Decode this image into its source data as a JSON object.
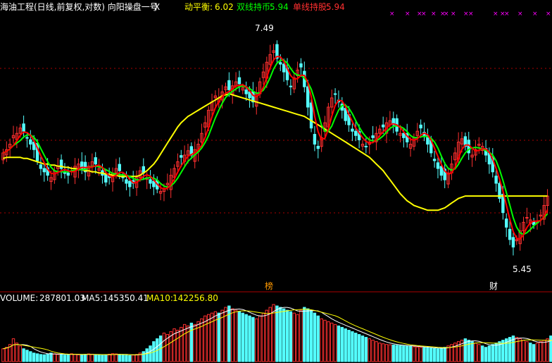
{
  "header": {
    "title": "海油工程(日线,前复权,对数) 向阳操盘一号",
    "close_mark": "X",
    "indicators": [
      {
        "label": "动平衡:",
        "value": "6.02",
        "color": "#ffff00"
      },
      {
        "label": "双线持币:",
        "value": "5.94",
        "color": "#00ff00"
      },
      {
        "label": "单线持股:",
        "value": "5.94",
        "color": "#ff3030"
      }
    ]
  },
  "volume_header": {
    "volume": {
      "label": "VOLUME:",
      "value": "287801.03"
    },
    "ma5": {
      "label": "MA5:",
      "value": "145350.41"
    },
    "ma10": {
      "label": "MA10:",
      "value": "142256.80"
    }
  },
  "markers": [
    {
      "label": "榜",
      "color": "#ff9900"
    },
    {
      "label": "财",
      "color": "#ffffff"
    }
  ],
  "colors": {
    "up": "#ff3030",
    "down": "#54ffff",
    "ma_slow": "#ffff00",
    "line_green": "#00ff00",
    "line_red": "#ff0000",
    "grid": "#aa0000",
    "sell_marker": "#ff00ff",
    "buy_arrow": "#00ff00",
    "sell_arrow": "#ff3030"
  },
  "chart_data": {
    "type": "candlestick",
    "price_scale": "log",
    "ylim": [
      5.25,
      7.7
    ],
    "annotations": [
      {
        "text": "7.49",
        "kind": "high",
        "value": 7.49
      },
      {
        "text": "5.45",
        "kind": "low",
        "value": 5.45
      }
    ],
    "candles_close": [
      6.32,
      6.35,
      6.4,
      6.48,
      6.5,
      6.55,
      6.52,
      6.46,
      6.4,
      6.35,
      6.25,
      6.18,
      6.15,
      6.12,
      6.1,
      6.16,
      6.2,
      6.18,
      6.14,
      6.12,
      6.16,
      6.2,
      6.22,
      6.18,
      6.15,
      6.2,
      6.24,
      6.22,
      6.18,
      6.12,
      6.06,
      6.1,
      6.14,
      6.18,
      6.16,
      6.1,
      6.05,
      6.02,
      6.05,
      6.1,
      6.16,
      6.14,
      6.1,
      6.05,
      6.02,
      6.0,
      5.98,
      6.0,
      6.05,
      6.12,
      6.18,
      6.24,
      6.28,
      6.3,
      6.34,
      6.3,
      6.35,
      6.4,
      6.5,
      6.6,
      6.72,
      6.8,
      6.86,
      6.84,
      6.9,
      6.95,
      6.92,
      6.96,
      7.0,
      6.98,
      6.94,
      6.88,
      6.84,
      6.8,
      6.88,
      7.0,
      7.1,
      7.2,
      7.28,
      7.32,
      7.24,
      7.18,
      7.1,
      7.02,
      6.95,
      7.04,
      7.12,
      7.15,
      6.95,
      6.75,
      6.55,
      6.4,
      6.36,
      6.46,
      6.6,
      6.75,
      6.84,
      6.88,
      6.8,
      6.72,
      6.62,
      6.58,
      6.52,
      6.48,
      6.44,
      6.4,
      6.38,
      6.42,
      6.46,
      6.5,
      6.54,
      6.56,
      6.6,
      6.62,
      6.58,
      6.52,
      6.5,
      6.46,
      6.42,
      6.4,
      6.46,
      6.52,
      6.55,
      6.48,
      6.4,
      6.32,
      6.25,
      6.18,
      6.12,
      6.08,
      6.14,
      6.22,
      6.32,
      6.42,
      6.45,
      6.38,
      6.32,
      6.3,
      6.35,
      6.4,
      6.38,
      6.3,
      6.22,
      6.15,
      6.05,
      5.92,
      5.8,
      5.68,
      5.58,
      5.52,
      5.58,
      5.65,
      5.72,
      5.76,
      5.74,
      5.7,
      5.72,
      5.78,
      5.86,
      5.94
    ],
    "ma_slow": [
      6.27,
      6.28,
      6.28,
      6.28,
      6.28,
      6.28,
      6.27,
      6.27,
      6.26,
      6.25,
      6.24,
      6.23,
      6.22,
      6.22,
      6.21,
      6.21,
      6.2,
      6.2,
      6.19,
      6.19,
      6.18,
      6.18,
      6.17,
      6.17,
      6.16,
      6.16,
      6.15,
      6.15,
      6.14,
      6.14,
      6.13,
      6.13,
      6.12,
      6.12,
      6.11,
      6.11,
      6.11,
      6.11,
      6.11,
      6.11,
      6.12,
      6.14,
      6.16,
      6.19,
      6.22,
      6.26,
      6.31,
      6.36,
      6.41,
      6.46,
      6.51,
      6.56,
      6.6,
      6.63,
      6.66,
      6.68,
      6.7,
      6.72,
      6.74,
      6.76,
      6.78,
      6.8,
      6.82,
      6.84,
      6.86,
      6.87,
      6.88,
      6.87,
      6.86,
      6.85,
      6.84,
      6.83,
      6.82,
      6.81,
      6.8,
      6.79,
      6.78,
      6.77,
      6.76,
      6.75,
      6.74,
      6.73,
      6.72,
      6.71,
      6.7,
      6.69,
      6.68,
      6.67,
      6.66,
      6.64,
      6.62,
      6.6,
      6.58,
      6.56,
      6.54,
      6.52,
      6.5,
      6.48,
      6.46,
      6.44,
      6.42,
      6.4,
      6.38,
      6.36,
      6.34,
      6.32,
      6.3,
      6.28,
      6.25,
      6.22,
      6.19,
      6.16,
      6.12,
      6.08,
      6.04,
      6.0,
      5.96,
      5.93,
      5.9,
      5.88,
      5.86,
      5.85,
      5.84,
      5.83,
      5.82,
      5.82,
      5.82,
      5.82,
      5.83,
      5.84,
      5.86,
      5.88,
      5.9,
      5.92,
      5.93,
      5.94,
      5.94,
      5.94,
      5.94,
      5.94,
      5.94,
      5.94,
      5.94,
      5.94,
      5.94,
      5.94,
      5.94,
      5.94,
      5.94,
      5.94,
      5.94,
      5.94,
      5.94,
      5.94,
      5.94,
      5.94,
      5.94,
      5.94,
      5.94,
      5.94
    ],
    "volume": [
      90,
      100,
      120,
      160,
      130,
      110,
      90,
      80,
      70,
      60,
      55,
      50,
      48,
      52,
      60,
      55,
      50,
      48,
      46,
      50,
      55,
      52,
      48,
      46,
      50,
      54,
      52,
      48,
      46,
      44,
      48,
      52,
      56,
      54,
      50,
      46,
      44,
      42,
      46,
      50,
      60,
      70,
      90,
      110,
      140,
      160,
      180,
      200,
      190,
      210,
      230,
      220,
      240,
      260,
      250,
      270,
      260,
      280,
      300,
      320,
      330,
      340,
      350,
      340,
      360,
      380,
      390,
      370,
      360,
      350,
      340,
      330,
      320,
      310,
      300,
      320,
      340,
      360,
      380,
      400,
      390,
      380,
      370,
      360,
      350,
      340,
      330,
      360,
      380,
      370,
      360,
      340,
      320,
      300,
      290,
      280,
      270,
      260,
      250,
      240,
      230,
      220,
      210,
      200,
      190,
      180,
      170,
      160,
      150,
      140,
      130,
      125,
      120,
      118,
      116,
      114,
      112,
      110,
      108,
      106,
      104,
      102,
      100,
      98,
      96,
      94,
      92,
      90,
      95,
      100,
      110,
      120,
      130,
      140,
      150,
      160,
      150,
      140,
      130,
      120,
      110,
      100,
      110,
      120,
      130,
      140,
      150,
      160,
      170,
      180,
      170,
      160,
      150,
      140,
      130,
      120,
      130,
      140,
      150,
      160,
      180,
      200,
      220,
      240,
      260,
      280,
      288
    ]
  }
}
